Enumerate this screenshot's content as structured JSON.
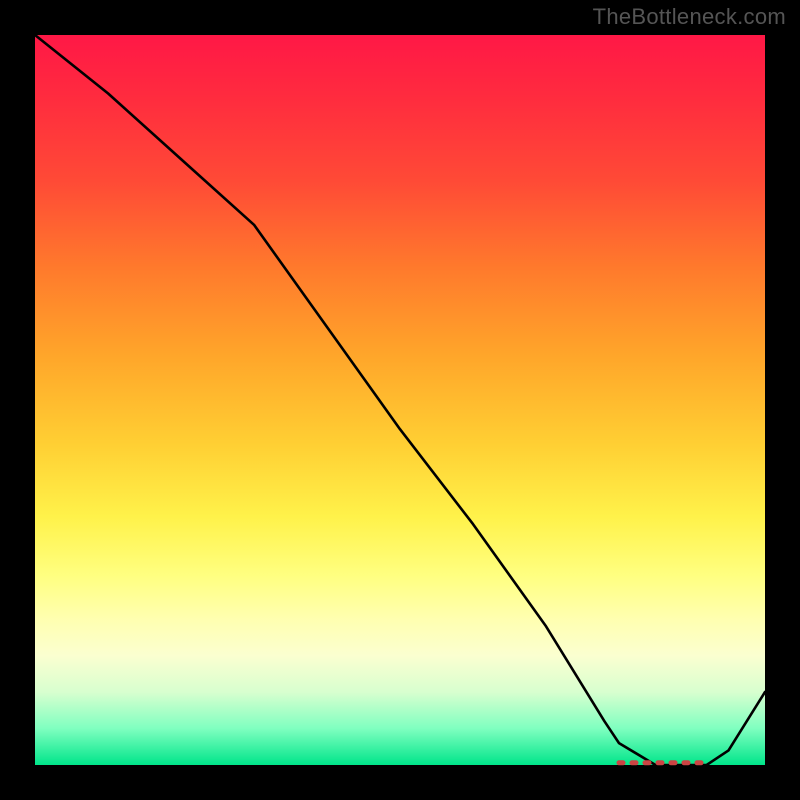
{
  "watermark": "TheBottleneck.com",
  "chart_data": {
    "type": "line",
    "title": "",
    "xlabel": "",
    "ylabel": "",
    "xlim": [
      0,
      100
    ],
    "ylim": [
      0,
      100
    ],
    "x": [
      0,
      10,
      20,
      30,
      40,
      50,
      60,
      70,
      78,
      80,
      85,
      90,
      92,
      95,
      100
    ],
    "values": [
      100,
      92,
      83,
      74,
      60,
      46,
      33,
      19,
      6,
      3,
      0,
      0,
      0,
      2,
      10
    ],
    "series": [
      {
        "name": "curve",
        "x": [
          0,
          10,
          20,
          30,
          40,
          50,
          60,
          70,
          78,
          80,
          85,
          90,
          92,
          95,
          100
        ],
        "values": [
          100,
          92,
          83,
          74,
          60,
          46,
          33,
          19,
          6,
          3,
          0,
          0,
          0,
          2,
          10
        ]
      }
    ],
    "gradient_stops": [
      {
        "pos": 0.0,
        "color": "#ff1846"
      },
      {
        "pos": 0.32,
        "color": "#ff7a2c"
      },
      {
        "pos": 0.66,
        "color": "#fff24a"
      },
      {
        "pos": 0.85,
        "color": "#fbffd0"
      },
      {
        "pos": 1.0,
        "color": "#00e58a"
      }
    ],
    "marker_band": {
      "x_start": 80,
      "x_end": 92,
      "y": 0,
      "style": "dotted",
      "color": "#cc4444"
    }
  }
}
